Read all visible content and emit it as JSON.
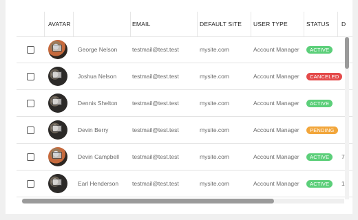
{
  "columns": {
    "avatar": "AVATAR",
    "email": "EMAIL",
    "default_site": "DEFAULT SITE",
    "user_type": "USER TYPE",
    "status": "STATUS",
    "truncated": "D"
  },
  "rows": [
    {
      "name": "George Nelson",
      "email": "testmail@test.test",
      "site": "mysite.com",
      "type": "Account Manager",
      "status": "ACTIVE",
      "status_color": "#5ccf7a",
      "extra": ""
    },
    {
      "name": "Joshua Nelson",
      "email": "testmail@test.test",
      "site": "mysite.com",
      "type": "Account Manager",
      "status": "CANCELED",
      "status_color": "#e44a4a",
      "extra": ""
    },
    {
      "name": "Dennis Shelton",
      "email": "testmail@test.test",
      "site": "mysite.com",
      "type": "Account Manager",
      "status": "ACTIVE",
      "status_color": "#5ccf7a",
      "extra": ""
    },
    {
      "name": "Devin Berry",
      "email": "testmail@test.test",
      "site": "mysite.com",
      "type": "Account Manager",
      "status": "PENDING",
      "status_color": "#f2a63b",
      "extra": ""
    },
    {
      "name": "Devin Campbell",
      "email": "testmail@test.test",
      "site": "mysite.com",
      "type": "Account Manager",
      "status": "ACTIVE",
      "status_color": "#5ccf7a",
      "extra": "7"
    },
    {
      "name": "Earl Henderson",
      "email": "testmail@test.test",
      "site": "mysite.com",
      "type": "Account Manager",
      "status": "ACTIVE",
      "status_color": "#5ccf7a",
      "extra": "1"
    }
  ]
}
